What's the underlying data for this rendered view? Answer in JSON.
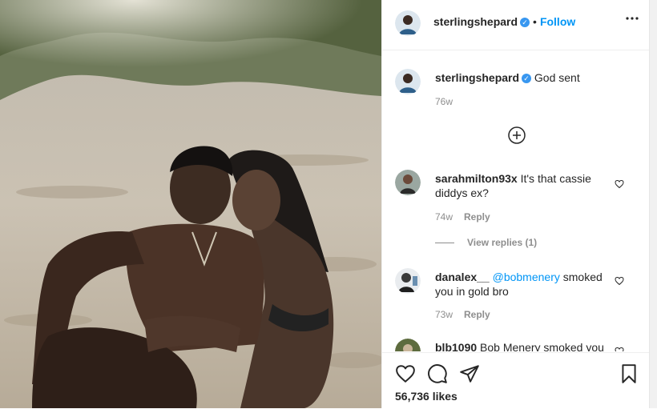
{
  "post": {
    "author": "sterlingshepard",
    "verified_badge": "✓",
    "dot": "•",
    "follow_label": "Follow",
    "more_icon": "more-horizontal-icon"
  },
  "caption": {
    "author": "sterlingshepard",
    "text": "God sent",
    "time": "76w"
  },
  "comments": [
    {
      "user": "sarahmilton93x",
      "line1": "It's that cassie",
      "line2": "diddys ex?",
      "time": "74w",
      "reply_label": "Reply",
      "view_replies": "View replies (1)"
    },
    {
      "user": "danalex__",
      "mention": "@bobmenery",
      "line1": "smoked",
      "line2": "you in gold bro",
      "time": "73w",
      "reply_label": "Reply"
    },
    {
      "user": "blb1090",
      "line1": "Bob Menery smoked you",
      "line2": ""
    }
  ],
  "footer": {
    "likes": "56,736 likes",
    "icons": [
      "heart-icon",
      "comment-icon",
      "share-icon",
      "bookmark-icon"
    ]
  },
  "colors": {
    "link": "#0095f6",
    "verified": "#3897f0",
    "muted": "#8e8e8e",
    "text": "#262626"
  }
}
